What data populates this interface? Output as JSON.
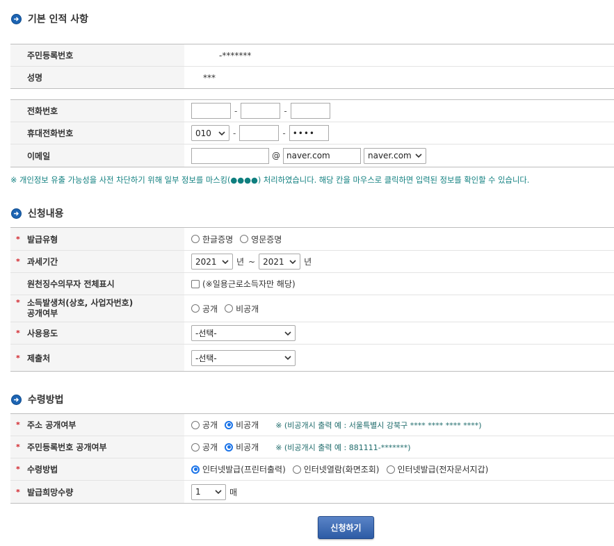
{
  "section1": {
    "title": "기본 인적 사항",
    "resident_label": "주민등록번호",
    "resident_value": "-*******",
    "name_label": "성명",
    "name_value": "***",
    "phone_label": "전화번호",
    "mobile_label": "휴대전화번호",
    "mobile_prefix": "010",
    "mobile_last": "••••",
    "email_label": "이메일",
    "email_at": "@",
    "email_domain": "naver.com",
    "email_domain_select": "naver.com"
  },
  "notice": "※ 개인정보 유출 가능성을 사전 차단하기 위해 일부 정보를 마스킹(●●●●) 처리하였습니다. 해당 칸을 마우스로 클릭하면 입력된 정보를 확인할 수 있습니다.",
  "section2": {
    "title": "신청내용",
    "req_mark": "*",
    "issue_type_label": "발급유형",
    "issue_type_opt1": "한글증명",
    "issue_type_opt2": "영문증명",
    "period_label": "과세기간",
    "period_from": "2021",
    "period_to": "2021",
    "year_unit": "년",
    "tilde": "~",
    "withholding_label": "원천징수의무자 전체표시",
    "withholding_note": "(※일용근로소득자만 해당)",
    "income_label_line1": "소득발생처(상호, 사업자번호)",
    "income_label_line2": "공개여부",
    "income_opt1": "공개",
    "income_opt2": "비공개",
    "usage_label": "사용용도",
    "usage_value": "-선택-",
    "submit_to_label": "제출처",
    "submit_to_value": "-선택-"
  },
  "section3": {
    "title": "수령방법",
    "address_label": "주소 공개여부",
    "address_opt1": "공개",
    "address_opt2": "비공개",
    "address_note": "※ (비공개시 출력 예 : 서울특별시 강북구 **** **** **** ****)",
    "rrn_label": "주민등록번호 공개여부",
    "rrn_opt1": "공개",
    "rrn_opt2": "비공개",
    "rrn_note": "※ (비공개시 출력 예 : 881111-*******)",
    "method_label": "수령방법",
    "method_opt1": "인터넷발급(프린터출력)",
    "method_opt2": "인터넷열람(화면조회)",
    "method_opt3": "인터넷발급(전자문서지갑)",
    "qty_label": "발급희망수량",
    "qty_value": "1",
    "qty_unit": "매"
  },
  "submit_button": "신청하기",
  "colors": {
    "accent": "#1c64b3",
    "required": "#d2232a",
    "notice": "#0f7f7f",
    "button": "#3a66ad"
  }
}
